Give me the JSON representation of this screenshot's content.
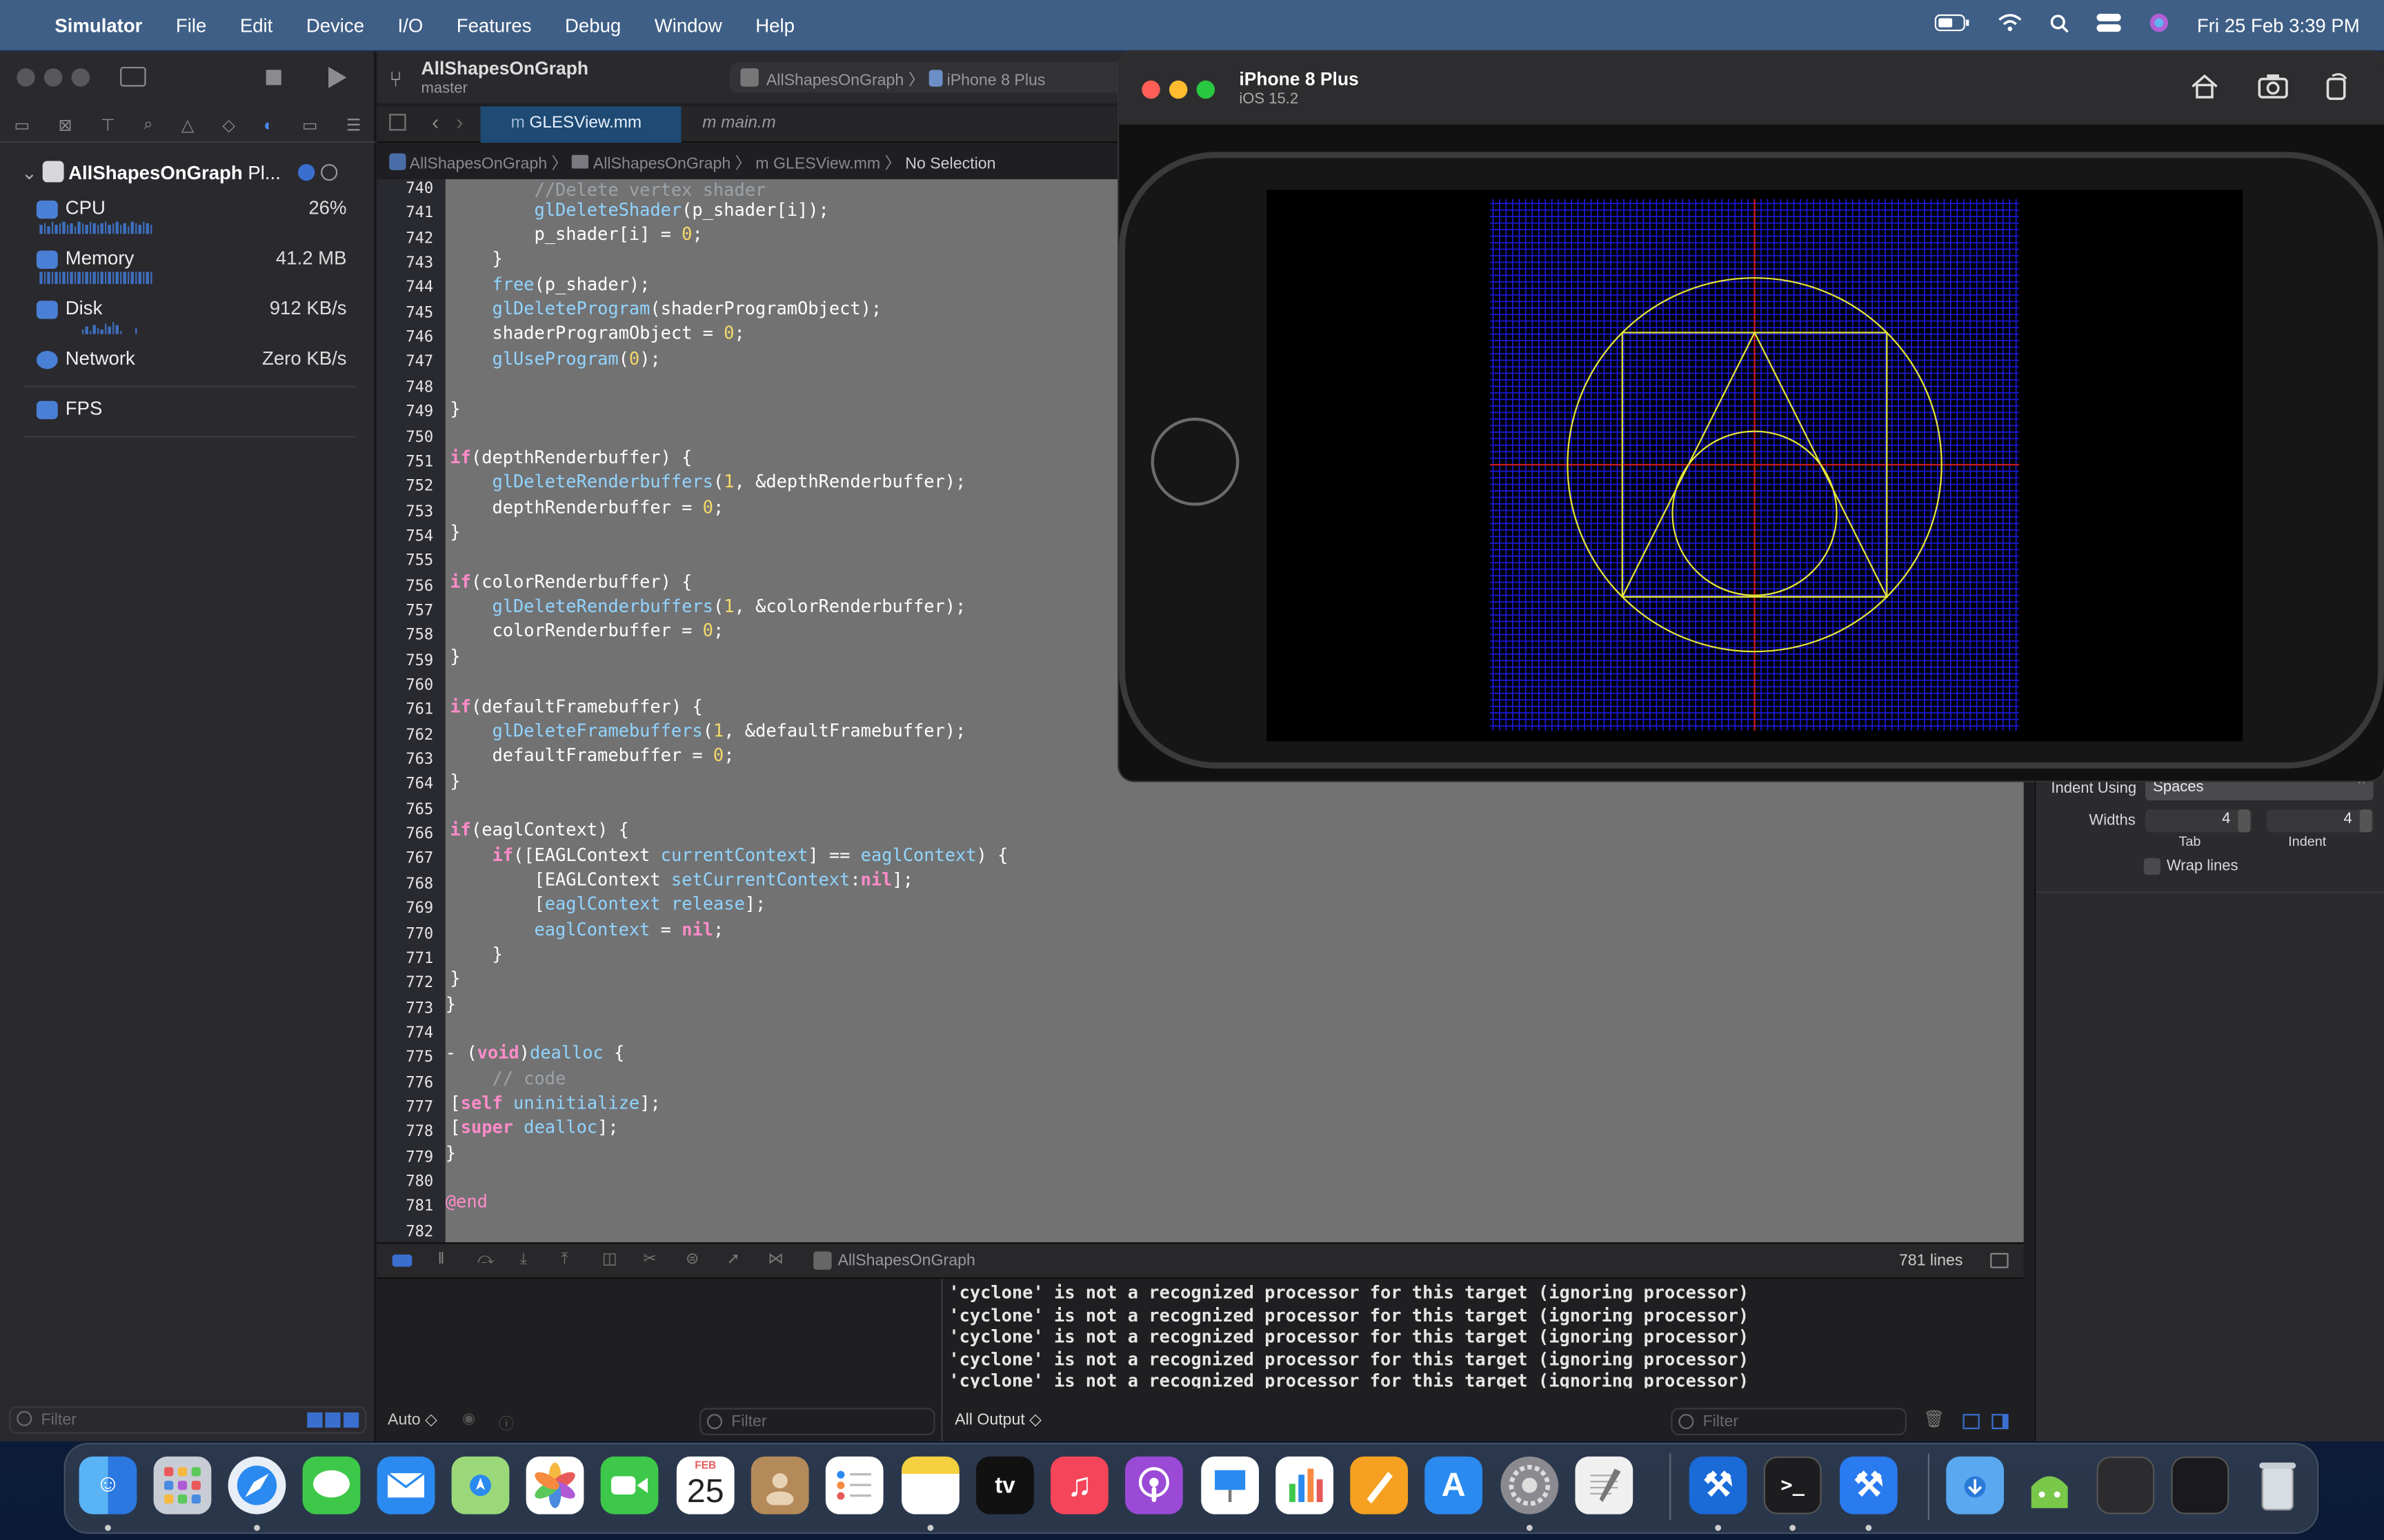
{
  "menubar": {
    "apple": "",
    "app": "Simulator",
    "items": [
      "File",
      "Edit",
      "Device",
      "I/O",
      "Features",
      "Debug",
      "Window",
      "Help"
    ],
    "clock": "Fri 25 Feb  3:39 PM"
  },
  "toolbar": {
    "project": "AllShapesOnGraph",
    "branch": "master",
    "scheme": "AllShapesOnGraph",
    "destination": "iPhone 8 Plus"
  },
  "navigator": {
    "root": "AllShapesOnGraph",
    "root_suffix": "Pl...",
    "gauges": [
      {
        "label": "CPU",
        "value": "26%"
      },
      {
        "label": "Memory",
        "value": "41.2 MB"
      },
      {
        "label": "Disk",
        "value": "912 KB/s"
      },
      {
        "label": "Network",
        "value": "Zero KB/s"
      }
    ],
    "fps": "FPS",
    "filter_placeholder": "Filter"
  },
  "tabs": [
    {
      "label": "GLESView.mm"
    },
    {
      "label": "main.m"
    }
  ],
  "jumpbar": [
    "AllShapesOnGraph",
    "AllShapesOnGraph",
    "GLESView.mm",
    "No Selection"
  ],
  "code": {
    "line_numbers": [
      "740",
      "741",
      "742",
      "743",
      "744",
      "745",
      "746",
      "747",
      "748",
      "749",
      "750",
      "751",
      "752",
      "753",
      "754",
      "755",
      "756",
      "757",
      "758",
      "759",
      "760",
      "761",
      "762",
      "763",
      "764",
      "765",
      "766",
      "767",
      "768",
      "769",
      "770",
      "771",
      "772",
      "773",
      "774",
      "775",
      "776",
      "777",
      "778",
      "779",
      "780",
      "781",
      "782"
    ]
  },
  "debug_bar": {
    "target": "AllShapesOnGraph",
    "lines": "781 lines"
  },
  "console": {
    "auto": "Auto ◇",
    "filter_placeholder": "Filter",
    "output_scope": "All Output ◇",
    "output": [
      "'cyclone' is not a recognized processor for this target (ignoring processor)",
      "'cyclone' is not a recognized processor for this target (ignoring processor)",
      "'cyclone' is not a recognized processor for this target (ignoring processor)",
      "'cyclone' is not a recognized processor for this target (ignoring processor)",
      "'cyclone' is not a recognized processor for this target (ignoring processor)"
    ]
  },
  "inspector": {
    "indent_using_label": "Indent Using",
    "indent_using_value": "Spaces",
    "widths_label": "Widths",
    "tab_value": "4",
    "indent_value": "4",
    "tab_label": "Tab",
    "indent_label": "Indent",
    "wrap_lines": "Wrap lines"
  },
  "simulator": {
    "device": "iPhone 8 Plus",
    "os": "iOS 15.2"
  },
  "dock": {
    "calendar_month": "FEB",
    "calendar_day": "25",
    "tv": "tv"
  },
  "colors": {
    "grid_blue": "#1a1ad6",
    "axis_red": "#d61a1a",
    "shape_yellow": "#e6e63a"
  }
}
